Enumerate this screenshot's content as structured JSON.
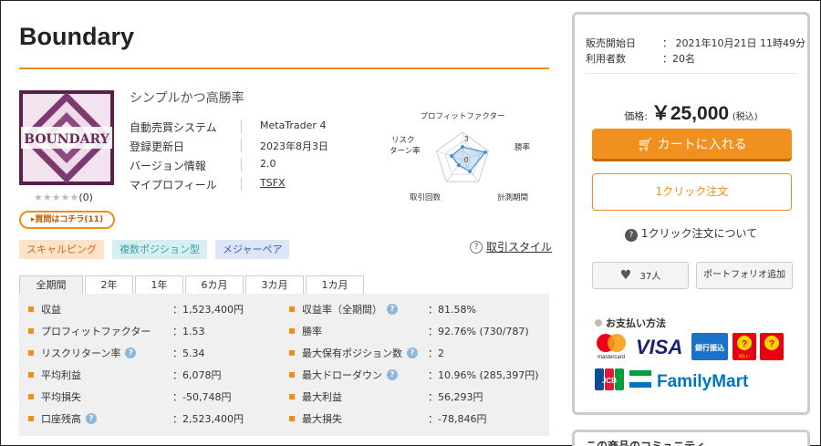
{
  "product": {
    "title": "Boundary",
    "subtitle": "シンプルかつ高勝率",
    "logo_text": "BOUNDARY",
    "rating_stars": "★★★★★",
    "review_count": "(0)",
    "review_button": "買問はコチラ(11)"
  },
  "info": [
    {
      "label": "自動売買システム",
      "value": "MetaTrader 4"
    },
    {
      "label": "登録更新日",
      "value": "2023年8月3日"
    },
    {
      "label": "バージョン情報",
      "value": "2.0"
    },
    {
      "label": "マイプロフィール",
      "value": "TSFX"
    }
  ],
  "radar": {
    "labels": {
      "top": "プロフィットファクター",
      "right": "勝率",
      "bottom_right": "計測期間",
      "bottom_left": "取引回数",
      "left": "リスク ターン率"
    },
    "scale_labels": [
      "3",
      "0"
    ]
  },
  "tags": [
    "スキャルピング",
    "複数ポジション型",
    "メジャーペア"
  ],
  "trade_style": "取引スタイル",
  "tabs": [
    "全期間",
    "2年",
    "1年",
    "6カ月",
    "3カ月",
    "1カ月"
  ],
  "stats_left": [
    {
      "label": "収益",
      "value": "：1,523,400円",
      "help": false
    },
    {
      "label": "プロフィットファクター",
      "value": "：1.53",
      "help": false
    },
    {
      "label": "リスクリターン率",
      "value": "：5.34",
      "help": true
    },
    {
      "label": "平均利益",
      "value": "：6,078円",
      "help": false
    },
    {
      "label": "平均損失",
      "value": "：-50,748円",
      "help": false
    },
    {
      "label": "口座残高",
      "value": "：2,523,400円",
      "help": true
    }
  ],
  "stats_right": [
    {
      "label": "収益率（全期間）",
      "value": "：81.58%",
      "help": true
    },
    {
      "label": "勝率",
      "value": "：92.76% (730/787)",
      "help": false
    },
    {
      "label": "最大保有ポジション数",
      "value": "：2",
      "help": true
    },
    {
      "label": "最大ドローダウン",
      "value": "：10.96% (285,397円)",
      "help": true
    },
    {
      "label": "最大利益",
      "value": "：56,293円",
      "help": false
    },
    {
      "label": "最大損失",
      "value": "：-78,846円",
      "help": false
    }
  ],
  "sidebar": {
    "sale_start_label": "販売開始日",
    "sale_start_value": "：  2021年10月21日 11時49分",
    "users_label": "利用者数",
    "users_value": "：20名",
    "price_label": "価格:",
    "price": "￥25,000",
    "tax": "(税込)",
    "cart_button": "カートに入れる",
    "oneclick_button": "1クリック注文",
    "oneclick_help": "1クリック注文について",
    "like_count": "37人",
    "portfolio_button": "ポートフォリオ追加",
    "payment_title": "お支払い方法",
    "payment_logos": [
      "mastercard",
      "VISA",
      "銀行振込",
      "d払い",
      "JCB",
      "FamilyMart"
    ],
    "community_title": "この商品のコミュニティ"
  },
  "colors": {
    "accent": "#f08c1e",
    "panel_bg": "#f0f0f0"
  }
}
